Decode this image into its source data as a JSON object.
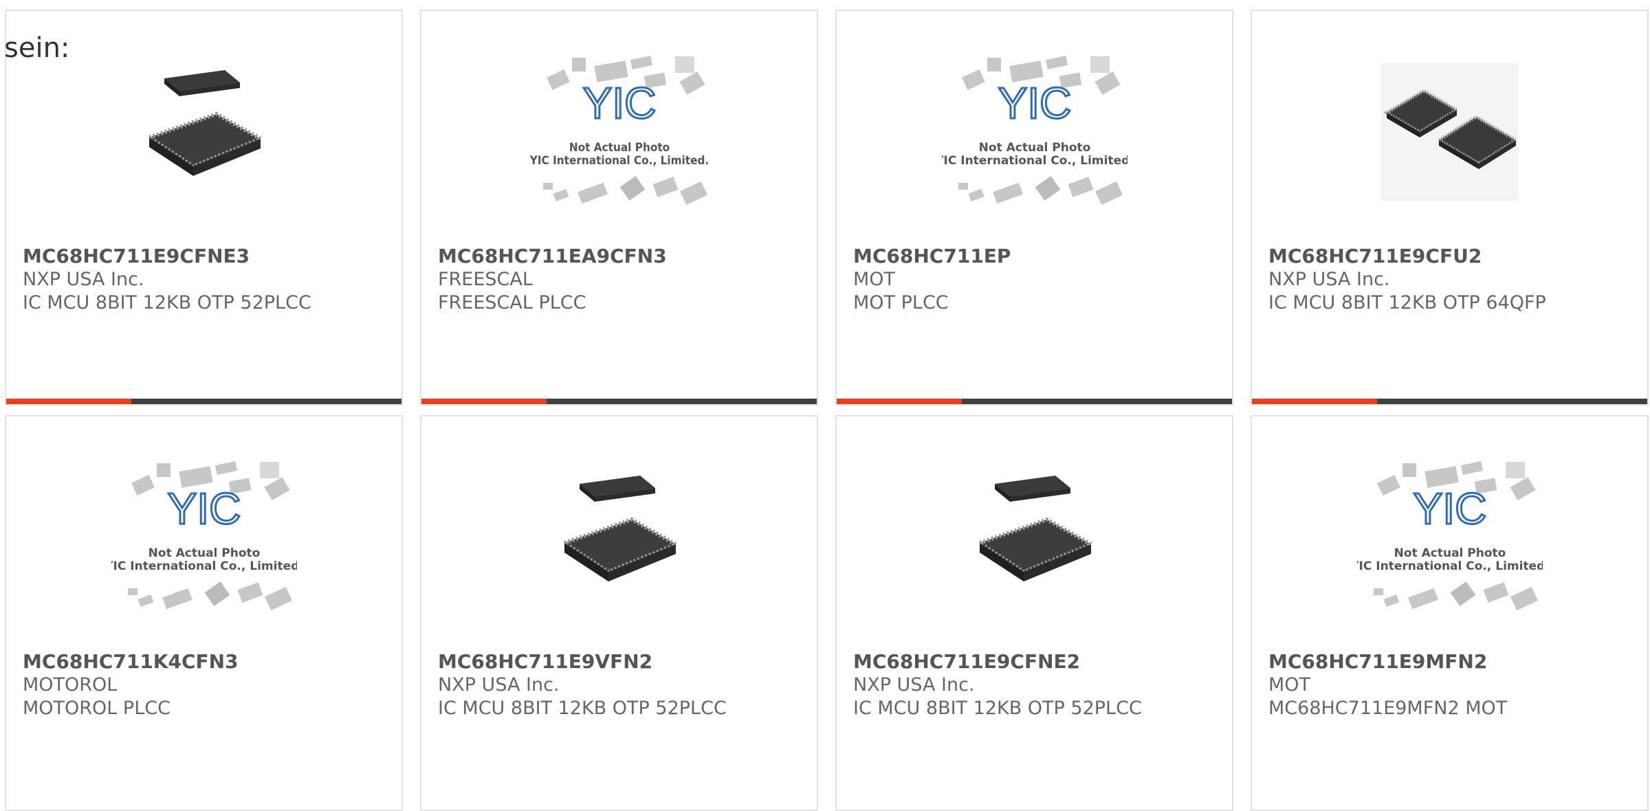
{
  "intro_text": "sein:",
  "colors": {
    "accent": "#e8401f",
    "bar": "#404040",
    "yic_blue": "#2d6db3"
  },
  "placeholder_caption": {
    "line1": "Not Actual Photo",
    "line2": "YIC International Co., Limited."
  },
  "logo_text": "YIC",
  "products": [
    {
      "part": "MC68HC711E9CFNE3",
      "manufacturer": "NXP USA Inc.",
      "description": "IC MCU 8BIT 12KB OTP 52PLCC",
      "image": "plcc-chip-image"
    },
    {
      "part": "MC68HC711EA9CFN3",
      "manufacturer": "FREESCAL",
      "description": "FREESCAL PLCC",
      "image": "placeholder-image"
    },
    {
      "part": "MC68HC711EP",
      "manufacturer": "MOT",
      "description": "MOT PLCC",
      "image": "placeholder-image"
    },
    {
      "part": "MC68HC711E9CFU2",
      "manufacturer": "NXP USA Inc.",
      "description": "IC MCU 8BIT 12KB OTP 64QFP",
      "image": "qfp-chip-image"
    },
    {
      "part": "MC68HC711K4CFN3",
      "manufacturer": "MOTOROL",
      "description": "MOTOROL PLCC",
      "image": "placeholder-image"
    },
    {
      "part": "MC68HC711E9VFN2",
      "manufacturer": "NXP USA Inc.",
      "description": "IC MCU 8BIT 12KB OTP 52PLCC",
      "image": "plcc-chip-image"
    },
    {
      "part": "MC68HC711E9CFNE2",
      "manufacturer": "NXP USA Inc.",
      "description": "IC MCU 8BIT 12KB OTP 52PLCC",
      "image": "plcc-chip-image"
    },
    {
      "part": "MC68HC711E9MFN2",
      "manufacturer": "MOT",
      "description": "MC68HC711E9MFN2 MOT",
      "image": "placeholder-image"
    }
  ]
}
